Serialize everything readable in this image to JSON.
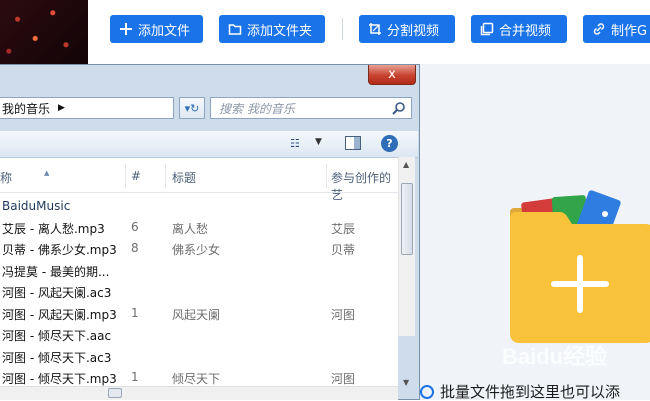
{
  "toolbar": {
    "buttons": [
      {
        "label": "添加文件",
        "icon": "plus-icon"
      },
      {
        "label": "添加文件夹",
        "icon": "folder-icon"
      },
      {
        "label": "分割视频",
        "icon": "crop-icon"
      },
      {
        "label": "合并视频",
        "icon": "copy-icon"
      },
      {
        "label": "制作G",
        "icon": "link-icon"
      }
    ],
    "accent": "#1a73e8"
  },
  "explorer": {
    "close_label": "x",
    "address": "我的音乐",
    "search_placeholder": "搜索 我的音乐",
    "columns": {
      "name": "称",
      "number": "#",
      "title": "标题",
      "artist": "参与创作的艺"
    },
    "group": "BaiduMusic",
    "rows": [
      {
        "name": "艾辰 - 离人愁.mp3",
        "number": "6",
        "title": "离人愁",
        "artist": "艾辰"
      },
      {
        "name": "贝蒂 - 佛系少女.mp3",
        "number": "8",
        "title": "佛系少女",
        "artist": "贝蒂"
      },
      {
        "name": "冯提莫 - 最美的期...",
        "number": "",
        "title": "",
        "artist": ""
      },
      {
        "name": "河图 - 风起天阑.ac3",
        "number": "",
        "title": "",
        "artist": ""
      },
      {
        "name": "河图 - 风起天阑.mp3",
        "number": "1",
        "title": "风起天阑",
        "artist": "河图"
      },
      {
        "name": "河图 - 倾尽天下.aac",
        "number": "",
        "title": "",
        "artist": ""
      },
      {
        "name": "河图 - 倾尽天下.ac3",
        "number": "",
        "title": "",
        "artist": ""
      },
      {
        "name": "河图 - 倾尽天下.mp3",
        "number": "1",
        "title": "倾尽天下",
        "artist": "河图"
      }
    ]
  },
  "drop_hint": "批量文件拖到这里也可以添",
  "watermark": "Baidu经验"
}
